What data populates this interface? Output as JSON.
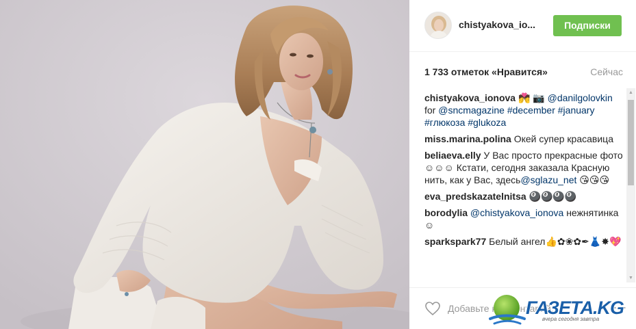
{
  "post": {
    "username": "chistyakova_io...",
    "follow_label": "Подписки",
    "likes": "1 733 отметок «Нравится»",
    "time": "Сейчас"
  },
  "comments": [
    {
      "user": "chistyakova_ionova",
      "parts": [
        {
          "type": "text",
          "text": " 💏 📷 "
        },
        {
          "type": "link",
          "text": "@danilgolovkin"
        },
        {
          "type": "text",
          "text": " for "
        },
        {
          "type": "link",
          "text": "@sncmagazine"
        },
        {
          "type": "text",
          "text": " "
        },
        {
          "type": "link",
          "text": "#december"
        },
        {
          "type": "text",
          "text": " "
        },
        {
          "type": "link",
          "text": "#january"
        },
        {
          "type": "text",
          "text": " "
        },
        {
          "type": "link",
          "text": "#глюкоза"
        },
        {
          "type": "text",
          "text": " "
        },
        {
          "type": "link",
          "text": "#glukoza"
        }
      ]
    },
    {
      "user": "miss.marina.polina",
      "parts": [
        {
          "type": "text",
          "text": " Окей супер красавица"
        }
      ]
    },
    {
      "user": "beliaeva.elly",
      "parts": [
        {
          "type": "text",
          "text": " У Вас просто прекрасные фото ☺☺☺ Кстати, сегодня заказала Красную нить, как у Вас, здесь"
        },
        {
          "type": "link",
          "text": "@sglazu_net"
        },
        {
          "type": "text",
          "text": " 😘😘😘"
        }
      ]
    },
    {
      "user": "eva_predskazatelnitsa",
      "parts": [
        {
          "type": "text",
          "text": " 🎱🎱🎱🎱"
        }
      ]
    },
    {
      "user": "borodylia",
      "parts": [
        {
          "type": "text",
          "text": " "
        },
        {
          "type": "link",
          "text": "@chistyakova_ionova"
        },
        {
          "type": "text",
          "text": " нежнятинка☺"
        }
      ]
    },
    {
      "user": "sparkspark77",
      "parts": [
        {
          "type": "text",
          "text": " Белый ангел👍✿❀✿✒👗✸💖"
        }
      ]
    }
  ],
  "footer": {
    "comment_placeholder": "Добавьте комментарий...",
    "more_label": "···"
  },
  "watermark": {
    "text": "ГАЗЕТА.KG",
    "tagline": "вчера сегодня завтра"
  },
  "icons": {
    "heart": "heart-icon",
    "more": "more-options-icon",
    "scroll_up": "scroll-up-arrow-icon",
    "scroll_down": "scroll-down-arrow-icon"
  },
  "colors": {
    "follow_button": "#70c050",
    "link": "#003569",
    "muted": "#999999"
  }
}
